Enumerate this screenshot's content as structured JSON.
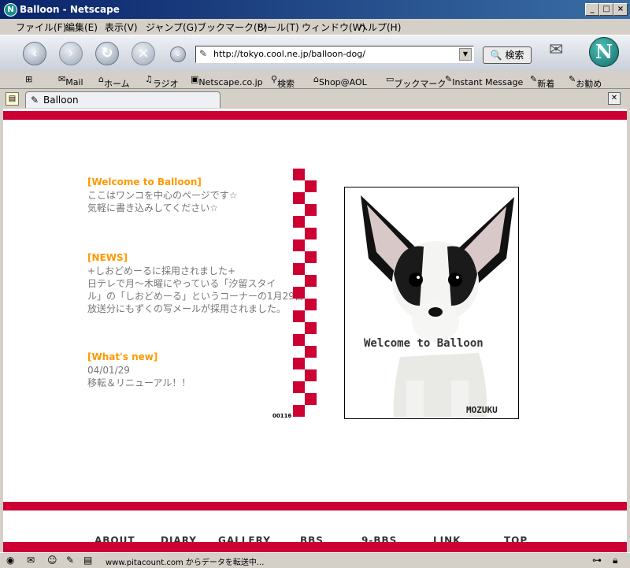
{
  "window": {
    "title": "Balloon - Netscape",
    "logo_letter": "N"
  },
  "menu": [
    "ファイル(F)",
    "編集(E)",
    "表示(V)",
    "ジャンプ(G)",
    "ブックマーク(B)",
    "ツール(T)",
    "ウィンドウ(W)",
    "ヘルプ(H)"
  ],
  "navbar": {
    "url": "http://tokyo.cool.ne.jp/balloon-dog/",
    "search_label": "🔍 検索",
    "brand_letter": "N"
  },
  "personal_toolbar": [
    "Mail",
    "ホーム",
    "ラジオ",
    "Netscape.co.jp",
    "検索",
    "Shop@AOL",
    "ブックマーク",
    "Instant Message",
    "新着",
    "お勧め"
  ],
  "tab": {
    "label": "Balloon"
  },
  "page": {
    "welcome": {
      "heading": "[Welcome to Balloon]",
      "lines": [
        "ここはワンコを中心のページです☆",
        "気軽に書き込みしてください☆"
      ]
    },
    "news": {
      "heading": "[NEWS]",
      "lines": [
        "+しおどめーるに採用されました+",
        "日テレで月～木曜にやっている「汐留スタイ",
        "ル」の「しおどめーる」というコーナーの1月29日",
        "放送分にもずくの写メールが採用されました。"
      ]
    },
    "whats_new": {
      "heading": "[What's new]",
      "date": "04/01/29",
      "text": "移転＆リニューアル！！"
    },
    "counter": "00116",
    "photo": {
      "caption": "Welcome to Balloon",
      "signature": "MOZUKU"
    },
    "bottom_nav": [
      "ABOUT",
      "DIARY",
      "GALLERY",
      "BBS",
      "9-BBS",
      "LINK",
      "TOP"
    ]
  },
  "status": {
    "text": "www.pitacount.com からデータを転送中..."
  },
  "colors": {
    "accent_red": "#cc0033",
    "heading_orange": "#ff9900",
    "body_gray": "#777777"
  }
}
